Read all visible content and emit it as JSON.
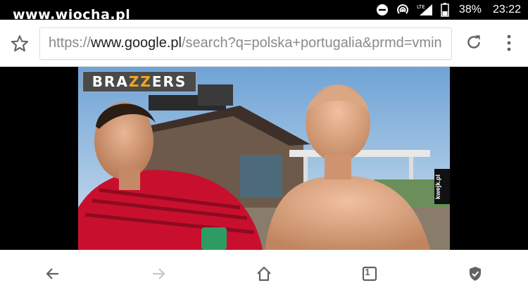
{
  "status": {
    "watermark": "www.wiocha.pl",
    "battery": "38%",
    "time": "23:22"
  },
  "toolbar": {
    "url_prefix": "https://",
    "url_domain": "www.google.pl",
    "url_path": "/search?q=polska+portugalia&prmd=vmin"
  },
  "image": {
    "brand_left": "BRA",
    "brand_mid": "ZZ",
    "brand_right": "ERS",
    "watermark": "kwejk.pl"
  },
  "nav": {
    "tab_count": "1"
  },
  "colors": {
    "accent_orange": "#f5a41b",
    "jersey_red": "#c8102e",
    "icon_gray": "#5f6368",
    "disabled_gray": "#c8c8c8"
  }
}
